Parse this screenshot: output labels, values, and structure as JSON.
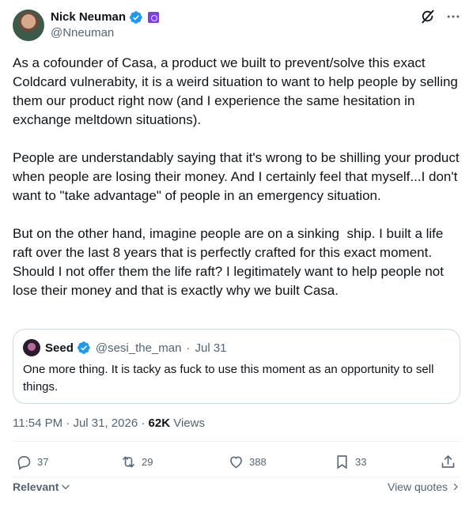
{
  "author": {
    "display_name": "Nick Neuman",
    "handle": "@Nneuman",
    "verified": true,
    "affiliate_badge": "purple-affiliate-badge"
  },
  "top_actions": {
    "grok_icon": "grok-icon",
    "more_icon": "more-icon"
  },
  "post": {
    "paragraphs": [
      "As a cofounder of Casa, a product we built to prevent/solve this exact Coldcard vulnerabity, it is a weird situation to want to help people by selling them our product right now (and I experience the same hesitation in exchange meltdown situations).",
      "People are understandably saying that it's wrong to be shilling your product when people are losing their money. And I certainly feel that myself...I don't want to \"take advantage\" of people in an emergency situation.",
      "But on the other hand, imagine people are on a sinking  ship. I built a life raft over the last 8 years that is perfectly crafted for this exact moment. Should I not offer them the life raft? I legitimately want to help people not lose their money and that is exactly why we built Casa."
    ]
  },
  "quote": {
    "display_name": "Seed",
    "handle": "@sesi_the_man",
    "separator": "·",
    "date": "Jul 31",
    "text": "One more thing. It is tacky as fuck to use this moment as an opportunity to sell things."
  },
  "meta": {
    "time": "11:54 PM",
    "dot1": "·",
    "date": "Jul 31, 2026",
    "dot2": "·",
    "views_count": "62K",
    "views_label": "Views"
  },
  "actions": {
    "replies": "37",
    "reposts": "29",
    "likes": "388",
    "bookmarks": "33"
  },
  "footer": {
    "sort_label": "Relevant",
    "view_quotes": "View quotes"
  },
  "colors": {
    "verified_blue": "#1d9bf0",
    "text_primary": "#0f1419",
    "text_secondary": "#536471",
    "border": "#cfd9de"
  }
}
